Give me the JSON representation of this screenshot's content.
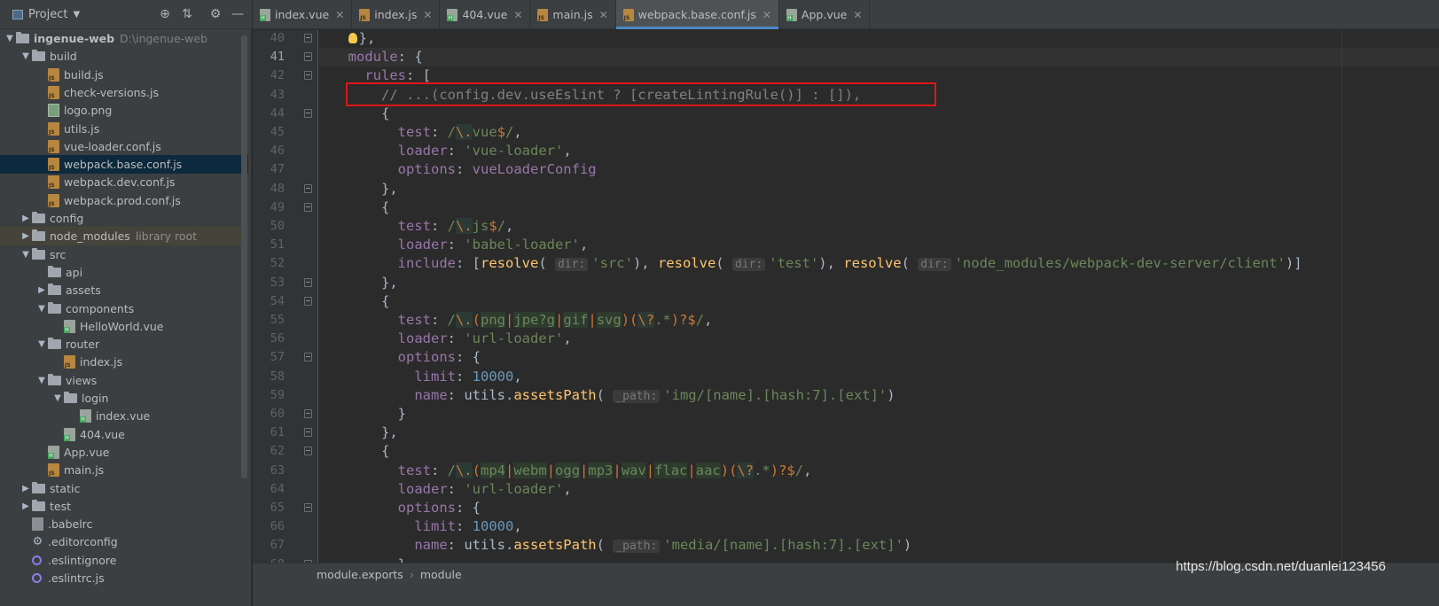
{
  "project_panel": {
    "title": "Project",
    "tree": [
      {
        "label": "ingenue-web",
        "tail": "D:\\ingenue-web",
        "type": "folder",
        "depth": 0,
        "arrow": "down",
        "bold": true
      },
      {
        "label": "build",
        "type": "folder",
        "depth": 1,
        "arrow": "down"
      },
      {
        "label": "build.js",
        "type": "js",
        "depth": 2
      },
      {
        "label": "check-versions.js",
        "type": "js",
        "depth": 2
      },
      {
        "label": "logo.png",
        "type": "png",
        "depth": 2
      },
      {
        "label": "utils.js",
        "type": "js",
        "depth": 2
      },
      {
        "label": "vue-loader.conf.js",
        "type": "js",
        "depth": 2
      },
      {
        "label": "webpack.base.conf.js",
        "type": "js",
        "depth": 2,
        "selected": true
      },
      {
        "label": "webpack.dev.conf.js",
        "type": "js",
        "depth": 2
      },
      {
        "label": "webpack.prod.conf.js",
        "type": "js",
        "depth": 2
      },
      {
        "label": "config",
        "type": "folder",
        "depth": 1,
        "arrow": "right"
      },
      {
        "label": "node_modules",
        "tail": "library root",
        "type": "folder",
        "depth": 1,
        "arrow": "right",
        "highlight": true
      },
      {
        "label": "src",
        "type": "folder",
        "depth": 1,
        "arrow": "down"
      },
      {
        "label": "api",
        "type": "folder",
        "depth": 2
      },
      {
        "label": "assets",
        "type": "folder",
        "depth": 2,
        "arrow": "right"
      },
      {
        "label": "components",
        "type": "folder",
        "depth": 2,
        "arrow": "down"
      },
      {
        "label": "HelloWorld.vue",
        "type": "vue",
        "depth": 3
      },
      {
        "label": "router",
        "type": "folder",
        "depth": 2,
        "arrow": "down"
      },
      {
        "label": "index.js",
        "type": "js",
        "depth": 3
      },
      {
        "label": "views",
        "type": "folder",
        "depth": 2,
        "arrow": "down"
      },
      {
        "label": "login",
        "type": "folder",
        "depth": 3,
        "arrow": "down"
      },
      {
        "label": "index.vue",
        "type": "vue",
        "depth": 4
      },
      {
        "label": "404.vue",
        "type": "vue",
        "depth": 3
      },
      {
        "label": "App.vue",
        "type": "vue",
        "depth": 2
      },
      {
        "label": "main.js",
        "type": "js",
        "depth": 2
      },
      {
        "label": "static",
        "type": "folder",
        "depth": 1,
        "arrow": "right"
      },
      {
        "label": "test",
        "type": "folder",
        "depth": 1,
        "arrow": "right"
      },
      {
        "label": ".babelrc",
        "type": "rc",
        "depth": 1
      },
      {
        "label": ".editorconfig",
        "type": "gear",
        "depth": 1
      },
      {
        "label": ".eslintignore",
        "type": "eslint",
        "depth": 1
      },
      {
        "label": ".eslintrc.js",
        "type": "eslint",
        "depth": 1
      }
    ]
  },
  "tabs": [
    {
      "label": "index.vue",
      "icon": "vue"
    },
    {
      "label": "index.js",
      "icon": "js"
    },
    {
      "label": "404.vue",
      "icon": "vue"
    },
    {
      "label": "main.js",
      "icon": "js"
    },
    {
      "label": "webpack.base.conf.js",
      "icon": "js",
      "active": true
    },
    {
      "label": "App.vue",
      "icon": "vue"
    }
  ],
  "editor": {
    "current_line": 41,
    "lines": [
      {
        "n": 40,
        "fold": true,
        "tokens": [
          [
            "",
            "  "
          ],
          [
            "bulb",
            ""
          ],
          [
            "",
            "},"
          ]
        ]
      },
      {
        "n": 41,
        "fold": true,
        "tokens": [
          [
            "",
            "  "
          ],
          [
            "kp",
            "module"
          ],
          [
            "",
            ": {"
          ]
        ]
      },
      {
        "n": 42,
        "fold": true,
        "tokens": [
          [
            "",
            "    "
          ],
          [
            "kp",
            "rules"
          ],
          [
            "",
            ": ["
          ]
        ]
      },
      {
        "n": 43,
        "tokens": [
          [
            "",
            "      "
          ],
          [
            "cm",
            "// ...(config.dev.useEslint ? [createLintingRule()] : []),"
          ]
        ]
      },
      {
        "n": 44,
        "fold": true,
        "tokens": [
          [
            "",
            "      {"
          ]
        ]
      },
      {
        "n": 45,
        "tokens": [
          [
            "",
            "        "
          ],
          [
            "kp",
            "test"
          ],
          [
            "",
            ": "
          ],
          [
            "rx",
            "/"
          ],
          [
            "rxe",
            "\\."
          ],
          [
            "rx",
            "vue"
          ],
          [
            "rxk",
            "$"
          ],
          [
            "rx",
            "/"
          ],
          [
            "",
            ","
          ]
        ]
      },
      {
        "n": 46,
        "tokens": [
          [
            "",
            "        "
          ],
          [
            "kp",
            "loader"
          ],
          [
            "",
            ": "
          ],
          [
            "st",
            "'vue-loader'"
          ],
          [
            "",
            ","
          ]
        ]
      },
      {
        "n": 47,
        "tokens": [
          [
            "",
            "        "
          ],
          [
            "kp",
            "options"
          ],
          [
            "",
            ": "
          ],
          [
            "kp",
            "vueLoaderConfig"
          ]
        ]
      },
      {
        "n": 48,
        "fold": true,
        "tokens": [
          [
            "",
            "      },"
          ]
        ]
      },
      {
        "n": 49,
        "fold": true,
        "tokens": [
          [
            "",
            "      {"
          ]
        ]
      },
      {
        "n": 50,
        "tokens": [
          [
            "",
            "        "
          ],
          [
            "kp",
            "test"
          ],
          [
            "",
            ": "
          ],
          [
            "rx",
            "/"
          ],
          [
            "rxe",
            "\\."
          ],
          [
            "rx",
            "js"
          ],
          [
            "rxk",
            "$"
          ],
          [
            "rx",
            "/"
          ],
          [
            "",
            ","
          ]
        ]
      },
      {
        "n": 51,
        "tokens": [
          [
            "",
            "        "
          ],
          [
            "kp",
            "loader"
          ],
          [
            "",
            ": "
          ],
          [
            "st",
            "'babel-loader'"
          ],
          [
            "",
            ","
          ]
        ]
      },
      {
        "n": 52,
        "tokens": [
          [
            "",
            "        "
          ],
          [
            "kp",
            "include"
          ],
          [
            "",
            ": ["
          ],
          [
            "fn",
            "resolve"
          ],
          [
            "",
            "( "
          ],
          [
            "hint",
            "dir:"
          ],
          [
            "st",
            "'src'"
          ],
          [
            "",
            "), "
          ],
          [
            "fn",
            "resolve"
          ],
          [
            "",
            "( "
          ],
          [
            "hint",
            "dir:"
          ],
          [
            "st",
            "'test'"
          ],
          [
            "",
            "), "
          ],
          [
            "fn",
            "resolve"
          ],
          [
            "",
            "( "
          ],
          [
            "hint",
            "dir:"
          ],
          [
            "st",
            "'node_modules/webpack-dev-server/client'"
          ],
          [
            "",
            ")]"
          ]
        ]
      },
      {
        "n": 53,
        "fold": true,
        "tokens": [
          [
            "",
            "      },"
          ]
        ]
      },
      {
        "n": 54,
        "fold": true,
        "tokens": [
          [
            "",
            "      {"
          ]
        ]
      },
      {
        "n": 55,
        "tokens": [
          [
            "",
            "        "
          ],
          [
            "kp",
            "test"
          ],
          [
            "",
            ": "
          ],
          [
            "rx",
            "/"
          ],
          [
            "rxe",
            "\\."
          ],
          [
            "rxk",
            "("
          ],
          [
            "rxg",
            "png"
          ],
          [
            "rxk",
            "|"
          ],
          [
            "rxg",
            "jpe?g"
          ],
          [
            "rxk",
            "|"
          ],
          [
            "rxg",
            "gif"
          ],
          [
            "rxk",
            "|"
          ],
          [
            "rxg",
            "svg"
          ],
          [
            "rxk",
            ")("
          ],
          [
            "rxe",
            "\\?"
          ],
          [
            "rx",
            ".*"
          ],
          [
            "rxk",
            ")?$"
          ],
          [
            "rx",
            "/"
          ],
          [
            "",
            ","
          ]
        ]
      },
      {
        "n": 56,
        "tokens": [
          [
            "",
            "        "
          ],
          [
            "kp",
            "loader"
          ],
          [
            "",
            ": "
          ],
          [
            "st",
            "'url-loader'"
          ],
          [
            "",
            ","
          ]
        ]
      },
      {
        "n": 57,
        "fold": true,
        "tokens": [
          [
            "",
            "        "
          ],
          [
            "kp",
            "options"
          ],
          [
            "",
            ": {"
          ]
        ]
      },
      {
        "n": 58,
        "tokens": [
          [
            "",
            "          "
          ],
          [
            "kp",
            "limit"
          ],
          [
            "",
            ": "
          ],
          [
            "nm",
            "10000"
          ],
          [
            "",
            ","
          ]
        ]
      },
      {
        "n": 59,
        "tokens": [
          [
            "",
            "          "
          ],
          [
            "kp",
            "name"
          ],
          [
            "",
            ": utils."
          ],
          [
            "fn",
            "assetsPath"
          ],
          [
            "",
            "( "
          ],
          [
            "hint",
            "_path:"
          ],
          [
            "st",
            "'img/[name].[hash:7].[ext]'"
          ],
          [
            "",
            ")"
          ]
        ]
      },
      {
        "n": 60,
        "fold": true,
        "tokens": [
          [
            "",
            "        }"
          ]
        ]
      },
      {
        "n": 61,
        "fold": true,
        "tokens": [
          [
            "",
            "      },"
          ]
        ]
      },
      {
        "n": 62,
        "fold": true,
        "tokens": [
          [
            "",
            "      {"
          ]
        ]
      },
      {
        "n": 63,
        "tokens": [
          [
            "",
            "        "
          ],
          [
            "kp",
            "test"
          ],
          [
            "",
            ": "
          ],
          [
            "rx",
            "/"
          ],
          [
            "rxe",
            "\\."
          ],
          [
            "rxk",
            "("
          ],
          [
            "rxg",
            "mp4"
          ],
          [
            "rxk",
            "|"
          ],
          [
            "rxg",
            "webm"
          ],
          [
            "rxk",
            "|"
          ],
          [
            "rxg",
            "ogg"
          ],
          [
            "rxk",
            "|"
          ],
          [
            "rxg",
            "mp3"
          ],
          [
            "rxk",
            "|"
          ],
          [
            "rxg",
            "wav"
          ],
          [
            "rxk",
            "|"
          ],
          [
            "rxg",
            "flac"
          ],
          [
            "rxk",
            "|"
          ],
          [
            "rxg",
            "aac"
          ],
          [
            "rxk",
            ")("
          ],
          [
            "rxe",
            "\\?"
          ],
          [
            "rx",
            ".*"
          ],
          [
            "rxk",
            ")?$"
          ],
          [
            "rx",
            "/"
          ],
          [
            "",
            ","
          ]
        ]
      },
      {
        "n": 64,
        "tokens": [
          [
            "",
            "        "
          ],
          [
            "kp",
            "loader"
          ],
          [
            "",
            ": "
          ],
          [
            "st",
            "'url-loader'"
          ],
          [
            "",
            ","
          ]
        ]
      },
      {
        "n": 65,
        "fold": true,
        "tokens": [
          [
            "",
            "        "
          ],
          [
            "kp",
            "options"
          ],
          [
            "",
            ": {"
          ]
        ]
      },
      {
        "n": 66,
        "tokens": [
          [
            "",
            "          "
          ],
          [
            "kp",
            "limit"
          ],
          [
            "",
            ": "
          ],
          [
            "nm",
            "10000"
          ],
          [
            "",
            ","
          ]
        ]
      },
      {
        "n": 67,
        "tokens": [
          [
            "",
            "          "
          ],
          [
            "kp",
            "name"
          ],
          [
            "",
            ": utils."
          ],
          [
            "fn",
            "assetsPath"
          ],
          [
            "",
            "( "
          ],
          [
            "hint",
            "_path:"
          ],
          [
            "st",
            "'media/[name].[hash:7].[ext]'"
          ],
          [
            "",
            ")"
          ]
        ]
      },
      {
        "n": 68,
        "fold": true,
        "tokens": [
          [
            "",
            "        }"
          ]
        ]
      }
    ]
  },
  "breadcrumb": [
    "module.exports",
    "module"
  ],
  "watermark": "https://blog.csdn.net/duanlei123456"
}
